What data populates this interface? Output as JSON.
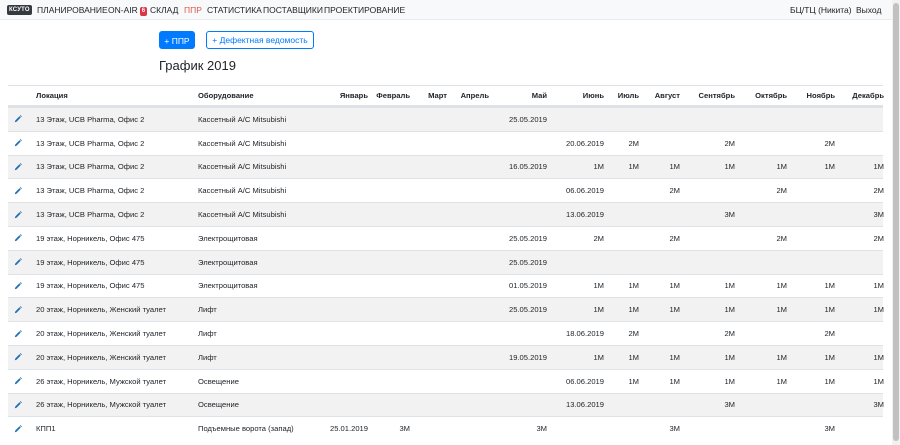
{
  "navbar": {
    "brand": "КСУТО",
    "items": [
      {
        "label": "ПЛАНИРОВАНИЕ"
      },
      {
        "label": "ON-AIR",
        "badge": "6"
      },
      {
        "label": "СКЛАД"
      },
      {
        "label": "ППР",
        "active": true
      },
      {
        "label": "СТАТИСТИКА"
      },
      {
        "label": "ПОСТАВЩИКИ"
      },
      {
        "label": "ПРОЕКТИРОВАНИЕ"
      }
    ],
    "user": "БЦ/ТЦ (Никита)",
    "logout": "Выход"
  },
  "actions": {
    "add_ppr": "+ ППР",
    "defect_statement": "+ Дефектная ведомость"
  },
  "page_title": "График 2019",
  "table": {
    "columns": [
      "Локация",
      "Оборудование",
      "Январь",
      "Февраль",
      "Март",
      "Апрель",
      "Май",
      "Июнь",
      "Июль",
      "Август",
      "Сентябрь",
      "Октябрь",
      "Ноябрь",
      "Декабрь"
    ],
    "rows": [
      [
        "13 Этаж, UCB Pharma, Офис 2",
        "Кассетный А/С Mitsubishi",
        "",
        "",
        "",
        "",
        "25.05.2019",
        "",
        "",
        "",
        "",
        "",
        "",
        ""
      ],
      [
        "13 Этаж, UCB Pharma, Офис 2",
        "Кассетный А/С Mitsubishi",
        "",
        "",
        "",
        "",
        "",
        "20.06.2019",
        "2M",
        "",
        "2M",
        "",
        "2M",
        ""
      ],
      [
        "13 Этаж, UCB Pharma, Офис 2",
        "Кассетный А/С Mitsubishi",
        "",
        "",
        "",
        "",
        "16.05.2019",
        "1M",
        "1M",
        "1M",
        "1M",
        "1M",
        "1M",
        "1M"
      ],
      [
        "13 Этаж, UCB Pharma, Офис 2",
        "Кассетный А/С Mitsubishi",
        "",
        "",
        "",
        "",
        "",
        "06.06.2019",
        "",
        "2M",
        "",
        "2M",
        "",
        "2M"
      ],
      [
        "13 Этаж, UCB Pharma, Офис 2",
        "Кассетный А/С Mitsubishi",
        "",
        "",
        "",
        "",
        "",
        "13.06.2019",
        "",
        "",
        "3M",
        "",
        "",
        "3M"
      ],
      [
        "19 этаж, Норникель, Офис 475",
        "Электрощитовая",
        "",
        "",
        "",
        "",
        "25.05.2019",
        "2M",
        "",
        "2M",
        "",
        "2M",
        "",
        "2M"
      ],
      [
        "19 этаж, Норникель, Офис 475",
        "Электрощитовая",
        "",
        "",
        "",
        "",
        "25.05.2019",
        "",
        "",
        "",
        "",
        "",
        "",
        ""
      ],
      [
        "19 этаж, Норникель, Офис 475",
        "Электрощитовая",
        "",
        "",
        "",
        "",
        "01.05.2019",
        "1M",
        "1M",
        "1M",
        "1M",
        "1M",
        "1M",
        "1M"
      ],
      [
        "20 этаж, Норникель, Женский туалет",
        "Лифт",
        "",
        "",
        "",
        "",
        "25.05.2019",
        "1M",
        "1M",
        "1M",
        "1M",
        "1M",
        "1M",
        "1M"
      ],
      [
        "20 этаж, Норникель, Женский туалет",
        "Лифт",
        "",
        "",
        "",
        "",
        "",
        "18.06.2019",
        "2M",
        "",
        "2M",
        "",
        "2M",
        ""
      ],
      [
        "20 этаж, Норникель, Женский туалет",
        "Лифт",
        "",
        "",
        "",
        "",
        "19.05.2019",
        "1M",
        "1M",
        "1M",
        "1M",
        "1M",
        "1M",
        "1M"
      ],
      [
        "26 этаж, Норникель, Мужской туалет",
        "Освещение",
        "",
        "",
        "",
        "",
        "",
        "06.06.2019",
        "1M",
        "1M",
        "1M",
        "1M",
        "1M",
        "1M"
      ],
      [
        "26 этаж, Норникель, Мужской туалет",
        "Освещение",
        "",
        "",
        "",
        "",
        "",
        "13.06.2019",
        "",
        "",
        "3M",
        "",
        "",
        "3M"
      ],
      [
        "КПП1",
        "Подъемные ворота (запад)",
        "25.01.2019",
        "3M",
        "",
        "",
        "3M",
        "",
        "",
        "3M",
        "",
        "",
        "3M",
        ""
      ]
    ]
  },
  "colors": {
    "primary": "#007bff",
    "active_nav": "#e05a4c",
    "badge": "#dc3545",
    "edit_icon": "#1f6fb5"
  },
  "icons": {
    "edit": "pencil-icon"
  }
}
